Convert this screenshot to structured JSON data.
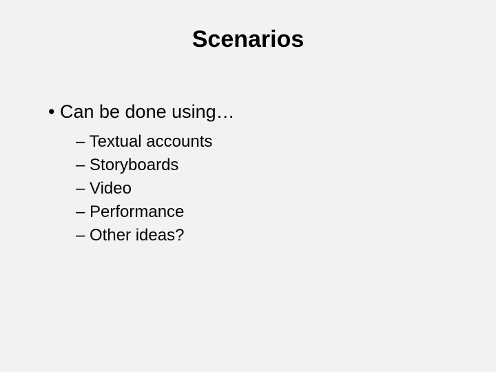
{
  "slide": {
    "title": "Scenarios",
    "bullet_main": "Can be done using…",
    "sub_items": [
      "Textual accounts",
      "Storyboards",
      "Video",
      "Performance",
      "Other ideas?"
    ]
  }
}
